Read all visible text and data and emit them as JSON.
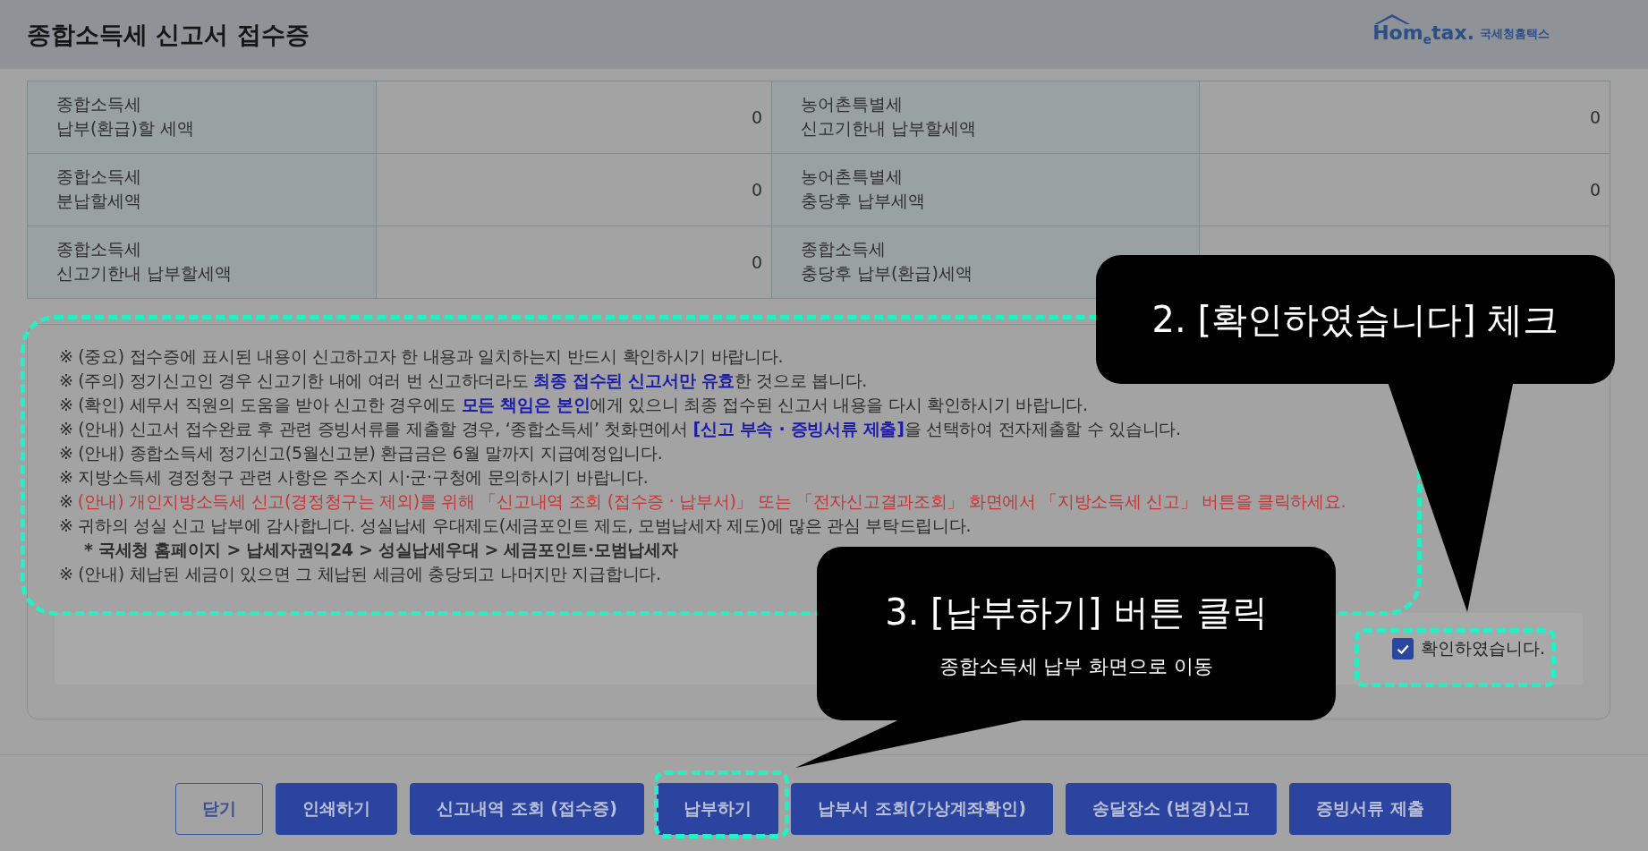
{
  "header": {
    "title": "종합소득세 신고서 접수증",
    "logo": {
      "brand": "Hom$_{e}$tax.",
      "sub": "국세청홈택스"
    }
  },
  "table": {
    "rows": [
      {
        "cells": [
          {
            "label": [
              "종합소득세",
              "납부(환급)할 세액"
            ],
            "value": "0"
          },
          {
            "label": [
              "농어촌특별세",
              "신고기한내 납부할세액"
            ],
            "value": "0"
          }
        ]
      },
      {
        "cells": [
          {
            "label": [
              "종합소득세",
              "분납할세액"
            ],
            "value": "0"
          },
          {
            "label": [
              "농어촌특별세",
              "충당후 납부세액"
            ],
            "value": "0"
          }
        ]
      },
      {
        "cells": [
          {
            "label": [
              "종합소득세",
              "신고기한내 납부할세액"
            ],
            "value": "0"
          },
          {
            "label": [
              "종합소득세",
              "충당후 납부(환급)세액"
            ]
          }
        ]
      }
    ]
  },
  "notes": [
    {
      "kind": "normal",
      "text": "※ (중요) 접수증에 표시된 내용이 신고하고자 한 내용과 일치하는지 반드시 확인하시기 바랍니다."
    },
    {
      "kind": "normal",
      "text": "※ (주의) 정기신고인 경우 신고기한 내에 여러 번 신고하더라도 **최종 접수된 신고서만 유효**한 것으로 봅니다."
    },
    {
      "kind": "normal",
      "text": "※ (확인) 세무서 직원의 도움을 받아 신고한 경우에도 **모든 책임은 본인**에게 있으니 최종 접수된 신고서 내용을 다시 확인하시기 바랍니다."
    },
    {
      "kind": "normal",
      "text": "※ (안내) 신고서 접수완료 후 관련 증빙서류를 제출할 경우, ‘종합소득세’ 첫화면에서 **[신고 부속 · 증빙서류 제출]**을 선택하여 전자제출할 수 있습니다."
    },
    {
      "kind": "normal",
      "text": "※ (안내) 종합소득세 정기신고(5월신고분) 환급금은 6월 말까지 지급예정입니다."
    },
    {
      "kind": "normal",
      "text": "※ 지방소득세 경정청구 관련 사항은 주소지 시·군·구청에 문의하시기 바랍니다."
    },
    {
      "kind": "alert",
      "mark": "※",
      "text": "(안내) 개인지방소득세 신고(경정청구는 제외)를 위해 「신고내역 조회 (접수증 · 납부서)」 또는 「전자신고결과조회」 화면에서 「지방소득세 신고」 버튼을 클릭하세요."
    },
    {
      "kind": "normal",
      "text": "※ 귀하의 성실 신고 납부에 감사합니다. 성실납세 우대제도(세금포인트 제도, 모범납세자 제도)에 많은 관심 부탁드립니다."
    },
    {
      "kind": "sub",
      "text": "* 국세청 홈페이지 > 납세자권익24 > 성실납세우대 > 세금포인트·모범납세자"
    },
    {
      "kind": "normal",
      "text": "※ (안내) 체납된 세금이 있으면 그 체납된 세금에 충당되고 나머지만 지급합니다."
    }
  ],
  "confirm": {
    "label": "확인하였습니다.",
    "checked": true
  },
  "buttons": [
    {
      "label": "닫기",
      "kind": "outline"
    },
    {
      "label": "인쇄하기",
      "kind": "filled"
    },
    {
      "label": "신고내역 조회 (접수증)",
      "kind": "filled"
    },
    {
      "label": "납부하기",
      "kind": "filled"
    },
    {
      "label": "납부서 조회(가상계좌확인)",
      "kind": "filled"
    },
    {
      "label": "송달장소 (변경)신고",
      "kind": "filled"
    },
    {
      "label": "증빙서류 제출",
      "kind": "filled"
    }
  ],
  "callouts": [
    {
      "title": "2. [확인하였습니다] 체크"
    },
    {
      "title": "3. [납부하기] 버튼 클릭",
      "subtitle": "종합소득세 납부 화면으로 이동"
    }
  ]
}
